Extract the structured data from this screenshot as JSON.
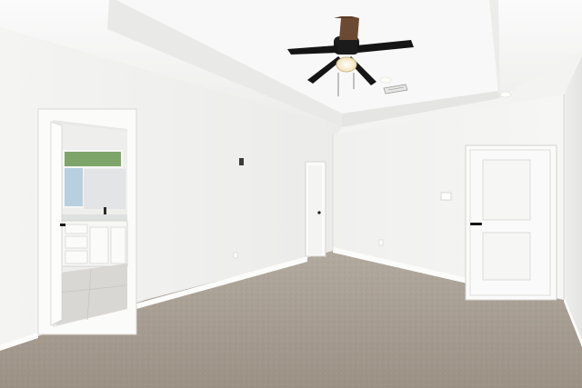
{
  "scene": {
    "type": "photo",
    "subject": "empty-bedroom-interior"
  },
  "colors": {
    "ceiling": "#f2f2f1",
    "wall_left": "#efefee",
    "wall_back": "#f4f4f3",
    "wall_right": "#ebebea",
    "carpet": "#a59b8f",
    "trim": "#fbfbfa",
    "fan_blade": "#141414",
    "fan_light": "#fff7e0",
    "door": "#fafafa",
    "bath_cabinet": "#f7f7f6",
    "bath_floor": "#d9d7d3"
  },
  "icons": [
    "ceiling-fan-icon",
    "door-handle-icon",
    "light-switch-icon",
    "air-vent-icon"
  ]
}
